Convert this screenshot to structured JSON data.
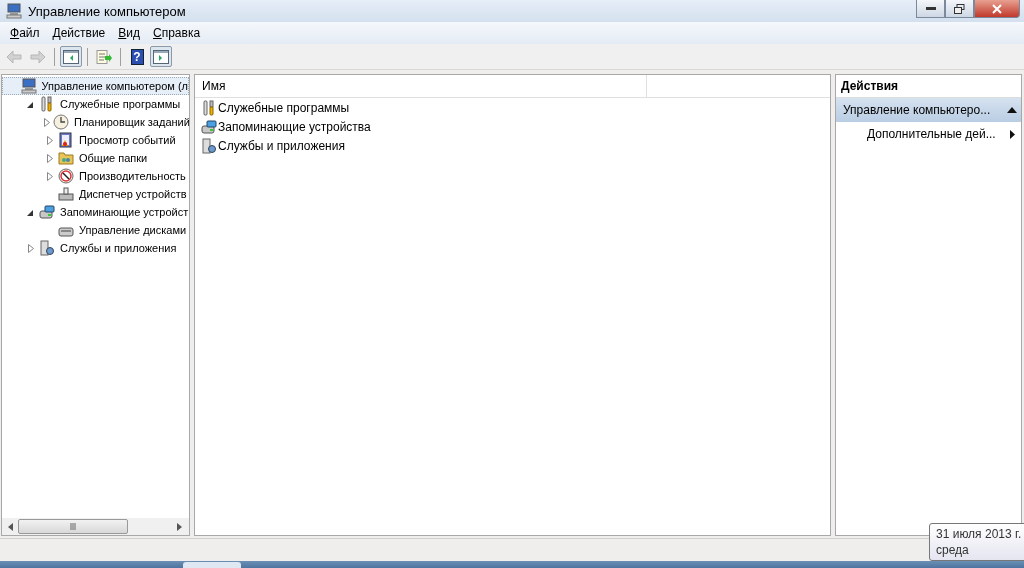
{
  "window": {
    "title": "Управление компьютером"
  },
  "menu": [
    {
      "label": "Файл"
    },
    {
      "label": "Действие"
    },
    {
      "label": "Вид"
    },
    {
      "label": "Справка"
    }
  ],
  "toolbar": [
    {
      "kind": "back",
      "disabled": true,
      "pressed": false
    },
    {
      "kind": "forward",
      "disabled": true,
      "pressed": false
    },
    {
      "kind": "tree",
      "disabled": false,
      "pressed": true
    },
    {
      "kind": "export",
      "disabled": false,
      "pressed": false
    },
    {
      "kind": "help",
      "label": "?",
      "disabled": false,
      "pressed": false
    },
    {
      "kind": "actions",
      "disabled": false,
      "pressed": true
    }
  ],
  "tree": [
    {
      "label": "Управление компьютером (л",
      "selected": true,
      "children": [
        {
          "label": "Служебные программы",
          "expanded": true,
          "selected": false,
          "children": [
            {
              "label": "Планировщик заданий",
              "expanded": false,
              "selected": false
            },
            {
              "label": "Просмотр событий",
              "expanded": false,
              "selected": false
            },
            {
              "label": "Общие папки",
              "expanded": false,
              "selected": false
            },
            {
              "label": "Производительность",
              "expanded": false,
              "selected": false
            },
            {
              "label": "Диспетчер устройств",
              "selected": false
            }
          ]
        },
        {
          "label": "Запоминающие устройст",
          "expanded": true,
          "selected": false,
          "children": [
            {
              "label": "Управление дисками",
              "selected": false
            }
          ]
        },
        {
          "label": "Службы и приложения",
          "expanded": false,
          "selected": false
        }
      ]
    }
  ],
  "list": {
    "columns": [
      "Имя"
    ],
    "rows": [
      "Служебные программы",
      "Запоминающие устройства",
      "Службы и приложения"
    ]
  },
  "actions": {
    "title": "Действия",
    "section": "Управление компьютеро...",
    "items": [
      "Дополнительные дей..."
    ]
  },
  "tooltip": {
    "lines": [
      "31 июля 2013 г.",
      "среда"
    ]
  }
}
